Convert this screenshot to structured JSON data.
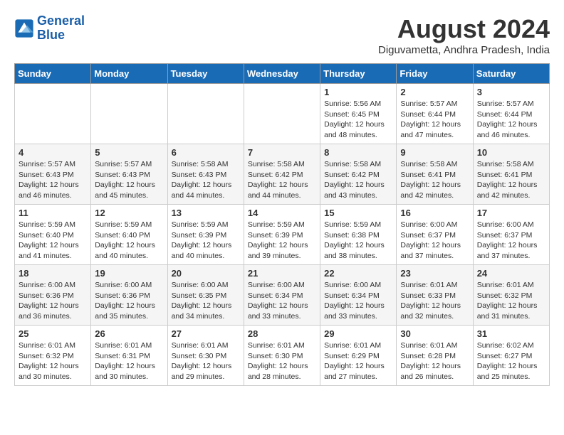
{
  "header": {
    "logo_general": "General",
    "logo_blue": "Blue",
    "month_year": "August 2024",
    "location": "Diguvametta, Andhra Pradesh, India"
  },
  "days_of_week": [
    "Sunday",
    "Monday",
    "Tuesday",
    "Wednesday",
    "Thursday",
    "Friday",
    "Saturday"
  ],
  "weeks": [
    [
      {
        "day": "",
        "info": ""
      },
      {
        "day": "",
        "info": ""
      },
      {
        "day": "",
        "info": ""
      },
      {
        "day": "",
        "info": ""
      },
      {
        "day": "1",
        "info": "Sunrise: 5:56 AM\nSunset: 6:45 PM\nDaylight: 12 hours\nand 48 minutes."
      },
      {
        "day": "2",
        "info": "Sunrise: 5:57 AM\nSunset: 6:44 PM\nDaylight: 12 hours\nand 47 minutes."
      },
      {
        "day": "3",
        "info": "Sunrise: 5:57 AM\nSunset: 6:44 PM\nDaylight: 12 hours\nand 46 minutes."
      }
    ],
    [
      {
        "day": "4",
        "info": "Sunrise: 5:57 AM\nSunset: 6:43 PM\nDaylight: 12 hours\nand 46 minutes."
      },
      {
        "day": "5",
        "info": "Sunrise: 5:57 AM\nSunset: 6:43 PM\nDaylight: 12 hours\nand 45 minutes."
      },
      {
        "day": "6",
        "info": "Sunrise: 5:58 AM\nSunset: 6:43 PM\nDaylight: 12 hours\nand 44 minutes."
      },
      {
        "day": "7",
        "info": "Sunrise: 5:58 AM\nSunset: 6:42 PM\nDaylight: 12 hours\nand 44 minutes."
      },
      {
        "day": "8",
        "info": "Sunrise: 5:58 AM\nSunset: 6:42 PM\nDaylight: 12 hours\nand 43 minutes."
      },
      {
        "day": "9",
        "info": "Sunrise: 5:58 AM\nSunset: 6:41 PM\nDaylight: 12 hours\nand 42 minutes."
      },
      {
        "day": "10",
        "info": "Sunrise: 5:58 AM\nSunset: 6:41 PM\nDaylight: 12 hours\nand 42 minutes."
      }
    ],
    [
      {
        "day": "11",
        "info": "Sunrise: 5:59 AM\nSunset: 6:40 PM\nDaylight: 12 hours\nand 41 minutes."
      },
      {
        "day": "12",
        "info": "Sunrise: 5:59 AM\nSunset: 6:40 PM\nDaylight: 12 hours\nand 40 minutes."
      },
      {
        "day": "13",
        "info": "Sunrise: 5:59 AM\nSunset: 6:39 PM\nDaylight: 12 hours\nand 40 minutes."
      },
      {
        "day": "14",
        "info": "Sunrise: 5:59 AM\nSunset: 6:39 PM\nDaylight: 12 hours\nand 39 minutes."
      },
      {
        "day": "15",
        "info": "Sunrise: 5:59 AM\nSunset: 6:38 PM\nDaylight: 12 hours\nand 38 minutes."
      },
      {
        "day": "16",
        "info": "Sunrise: 6:00 AM\nSunset: 6:37 PM\nDaylight: 12 hours\nand 37 minutes."
      },
      {
        "day": "17",
        "info": "Sunrise: 6:00 AM\nSunset: 6:37 PM\nDaylight: 12 hours\nand 37 minutes."
      }
    ],
    [
      {
        "day": "18",
        "info": "Sunrise: 6:00 AM\nSunset: 6:36 PM\nDaylight: 12 hours\nand 36 minutes."
      },
      {
        "day": "19",
        "info": "Sunrise: 6:00 AM\nSunset: 6:36 PM\nDaylight: 12 hours\nand 35 minutes."
      },
      {
        "day": "20",
        "info": "Sunrise: 6:00 AM\nSunset: 6:35 PM\nDaylight: 12 hours\nand 34 minutes."
      },
      {
        "day": "21",
        "info": "Sunrise: 6:00 AM\nSunset: 6:34 PM\nDaylight: 12 hours\nand 33 minutes."
      },
      {
        "day": "22",
        "info": "Sunrise: 6:00 AM\nSunset: 6:34 PM\nDaylight: 12 hours\nand 33 minutes."
      },
      {
        "day": "23",
        "info": "Sunrise: 6:01 AM\nSunset: 6:33 PM\nDaylight: 12 hours\nand 32 minutes."
      },
      {
        "day": "24",
        "info": "Sunrise: 6:01 AM\nSunset: 6:32 PM\nDaylight: 12 hours\nand 31 minutes."
      }
    ],
    [
      {
        "day": "25",
        "info": "Sunrise: 6:01 AM\nSunset: 6:32 PM\nDaylight: 12 hours\nand 30 minutes."
      },
      {
        "day": "26",
        "info": "Sunrise: 6:01 AM\nSunset: 6:31 PM\nDaylight: 12 hours\nand 30 minutes."
      },
      {
        "day": "27",
        "info": "Sunrise: 6:01 AM\nSunset: 6:30 PM\nDaylight: 12 hours\nand 29 minutes."
      },
      {
        "day": "28",
        "info": "Sunrise: 6:01 AM\nSunset: 6:30 PM\nDaylight: 12 hours\nand 28 minutes."
      },
      {
        "day": "29",
        "info": "Sunrise: 6:01 AM\nSunset: 6:29 PM\nDaylight: 12 hours\nand 27 minutes."
      },
      {
        "day": "30",
        "info": "Sunrise: 6:01 AM\nSunset: 6:28 PM\nDaylight: 12 hours\nand 26 minutes."
      },
      {
        "day": "31",
        "info": "Sunrise: 6:02 AM\nSunset: 6:27 PM\nDaylight: 12 hours\nand 25 minutes."
      }
    ]
  ]
}
